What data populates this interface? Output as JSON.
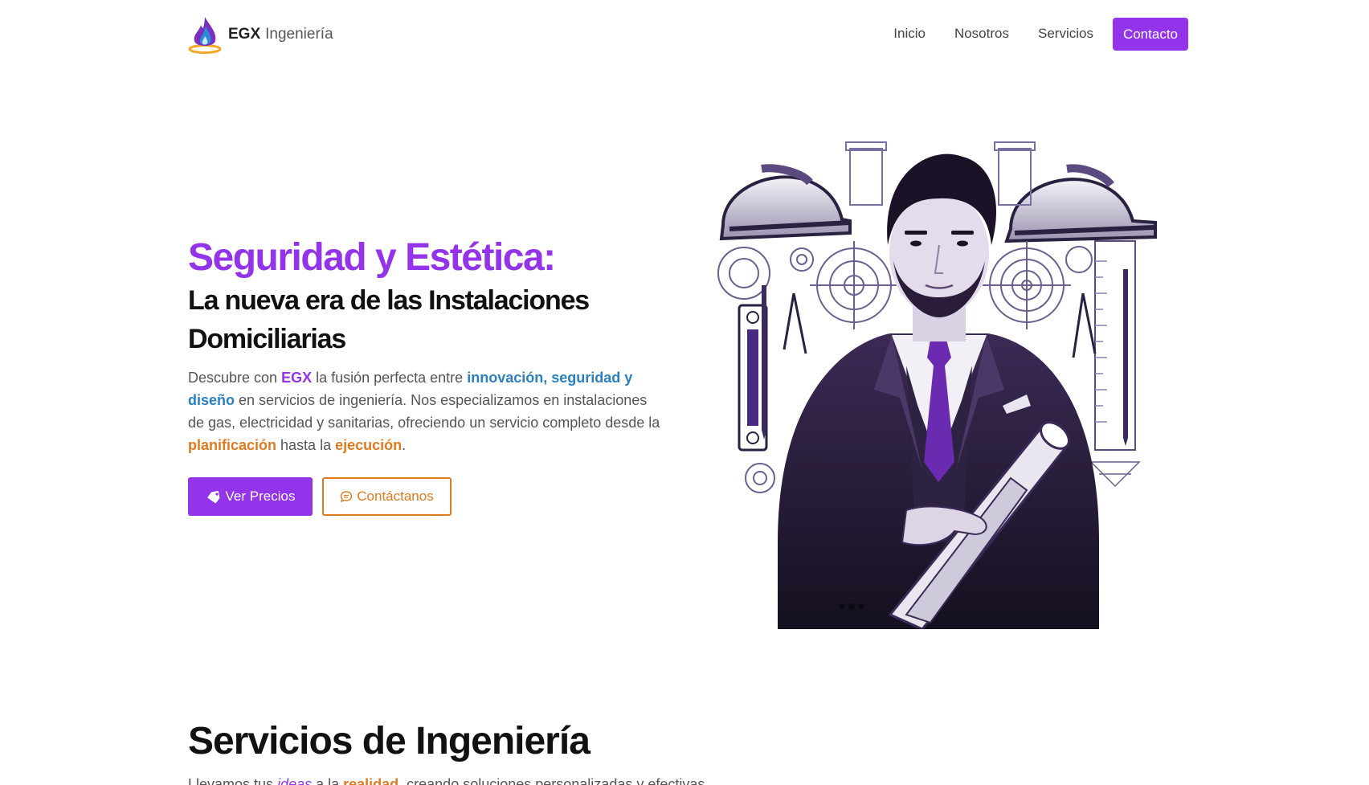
{
  "brand": {
    "name": "EGX",
    "sub": "Ingeniería"
  },
  "nav": {
    "items": [
      {
        "label": "Inicio"
      },
      {
        "label": "Nosotros"
      },
      {
        "label": "Servicios"
      }
    ],
    "cta": "Contacto"
  },
  "hero": {
    "title": "Seguridad y Estética:",
    "subtitle": "La nueva era de las Instalaciones Domiciliarias",
    "text": {
      "p1": "Descubre con ",
      "brand": "EGX",
      "p2": " la fusión perfecta entre ",
      "hl1": "innovación, seguridad y diseño",
      "p3": " en servicios de ingeniería. Nos especializamos en instalaciones de gas, electricidad y sanitarias, ofreciendo un servicio completo desde la ",
      "hl2": "planificación",
      "p4": " hasta la ",
      "hl3": "ejecución",
      "p5": "."
    },
    "btn_primary": "Ver Precios",
    "btn_secondary": "Contáctanos"
  },
  "services": {
    "title": "Servicios de Ingeniería",
    "text": {
      "p1": "Llevamos tus ",
      "ideas": "ideas",
      "p2": " a la ",
      "realidad": "realidad",
      "p3": ", creando soluciones personalizadas y efectivas."
    }
  },
  "colors": {
    "accent": "#9333ea",
    "blue": "#2a7fc1",
    "orange": "#e07a1f"
  }
}
